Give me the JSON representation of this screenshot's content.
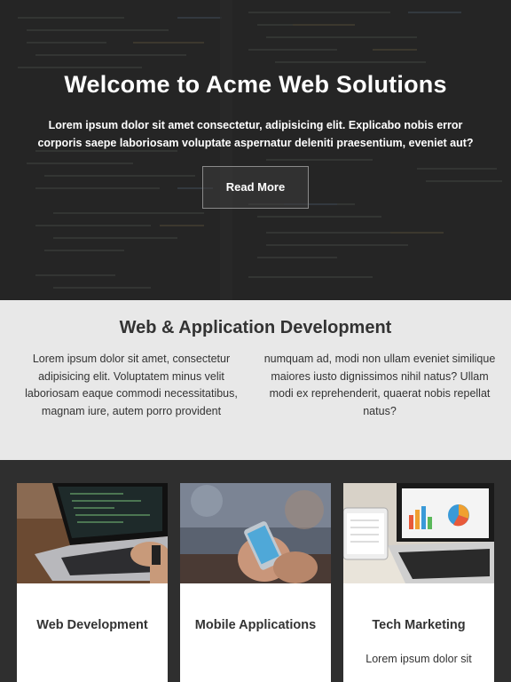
{
  "hero": {
    "title": "Welcome to Acme Web Solutions",
    "description": "Lorem ipsum dolor sit amet consectetur, adipisicing elit. Explicabo nobis error corporis saepe laboriosam voluptate aspernatur deleniti praesentium, eveniet aut?",
    "button_label": "Read More"
  },
  "section": {
    "title": "Web & Application Development",
    "col_left": "Lorem ipsum dolor sit amet, consectetur adipisicing elit. Voluptatem minus velit laboriosam eaque commodi necessitatibus, magnam iure, autem porro provident",
    "col_right": "numquam ad, modi non ullam eveniet similique maiores iusto dignissimos nihil natus? Ullam modi ex reprehenderit, quaerat nobis repellat natus?"
  },
  "cards": [
    {
      "title": "Web Development",
      "text": ""
    },
    {
      "title": "Mobile Applications",
      "text": ""
    },
    {
      "title": "Tech Marketing",
      "text": "Lorem ipsum dolor sit"
    }
  ],
  "colors": {
    "hero_bg": "#262626",
    "section_bg": "#e8e8e8",
    "cards_bg": "#2f2f2f",
    "card_bg": "#ffffff",
    "text_dark": "#333333",
    "text_light": "#ffffff"
  }
}
